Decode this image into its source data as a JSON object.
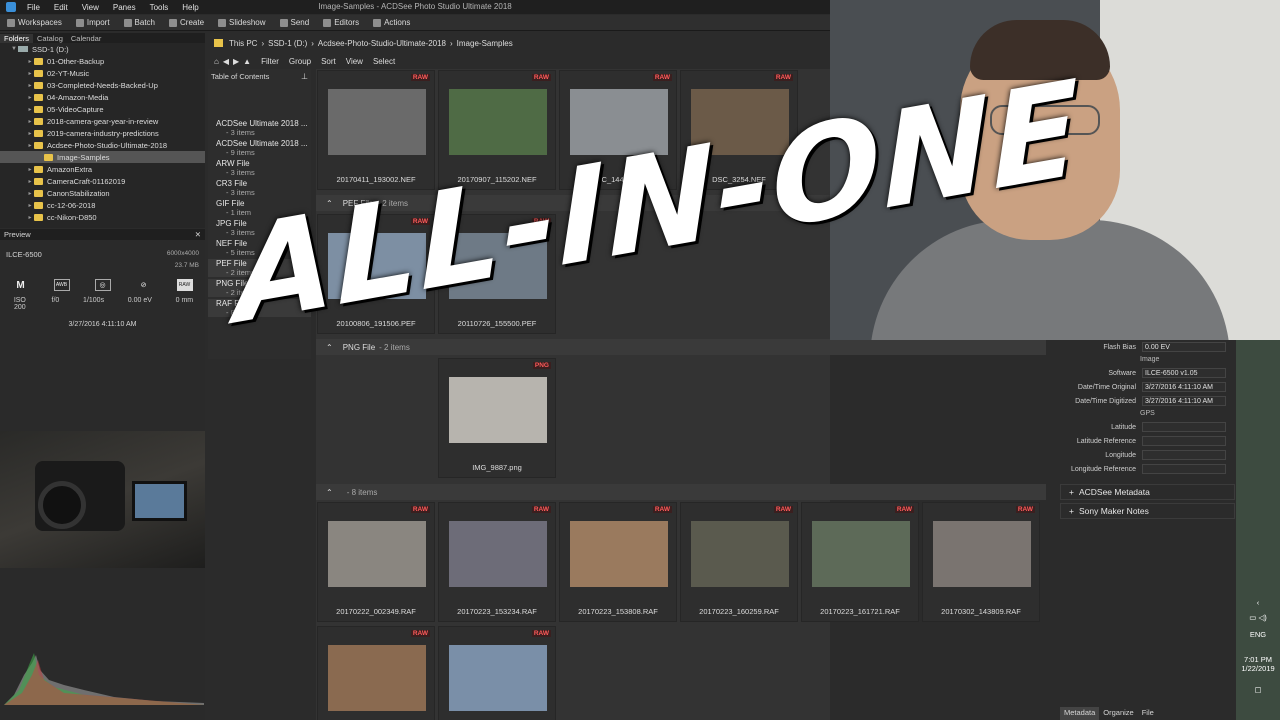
{
  "window": {
    "title": "Image-Samples - ACDSee Photo Studio Ultimate 2018"
  },
  "menu": [
    "File",
    "Edit",
    "View",
    "Panes",
    "Tools",
    "Help"
  ],
  "toolbar": [
    "Workspaces",
    "Import",
    "Batch",
    "Create",
    "Slideshow",
    "Send",
    "Editors",
    "Actions"
  ],
  "folders": {
    "tabs": [
      "Folders",
      "Catalog",
      "Calendar"
    ],
    "drive": "SSD-1 (D:)",
    "items": [
      {
        "label": "01-Other-Backup",
        "selected": false,
        "indent": 1
      },
      {
        "label": "02-YT-Music",
        "selected": false,
        "indent": 1
      },
      {
        "label": "03-Completed-Needs-Backed-Up",
        "selected": false,
        "indent": 1
      },
      {
        "label": "04-Amazon-Media",
        "selected": false,
        "indent": 1
      },
      {
        "label": "05-VideoCapture",
        "selected": false,
        "indent": 1
      },
      {
        "label": "2018-camera-gear-year-in-review",
        "selected": false,
        "indent": 1
      },
      {
        "label": "2019-camera-industry-predictions",
        "selected": false,
        "indent": 1
      },
      {
        "label": "Acdsee-Photo-Studio-Ultimate-2018",
        "selected": false,
        "indent": 1
      },
      {
        "label": "Image-Samples",
        "selected": true,
        "indent": 2
      },
      {
        "label": "AmazonExtra",
        "selected": false,
        "indent": 1
      },
      {
        "label": "CameraCraft-01162019",
        "selected": false,
        "indent": 1
      },
      {
        "label": "CanonStabilization",
        "selected": false,
        "indent": 1
      },
      {
        "label": "cc-12-06-2018",
        "selected": false,
        "indent": 1
      },
      {
        "label": "cc-Nikon-D850",
        "selected": false,
        "indent": 1
      }
    ]
  },
  "preview": {
    "title": "Preview",
    "camera": "ILCE-6500",
    "dimensions": "6000x4000",
    "filesize": "23.7 MB",
    "icons": [
      "M",
      "AWB",
      "metering",
      "flash-off",
      "RAW"
    ],
    "values": [
      "ISO 200",
      "f/0",
      "1/100s",
      "0.00 eV",
      "0 mm"
    ],
    "datetime": "3/27/2016 4:11:10 AM"
  },
  "path": {
    "segments": [
      "This PC",
      "SSD-1 (D:)",
      "Acdsee-Photo-Studio-Ultimate-2018",
      "Image-Samples"
    ]
  },
  "filterbar": [
    "Filter",
    "Group",
    "Sort",
    "View",
    "Select"
  ],
  "toc": {
    "title": "Table of Contents",
    "items": [
      {
        "name": "ACDSee Ultimate 2018 ...",
        "count": "- 3 items"
      },
      {
        "name": "ACDSee Ultimate 2018 ...",
        "count": "- 9 items"
      },
      {
        "name": "ARW File",
        "count": "- 3 items"
      },
      {
        "name": "CR3 File",
        "count": "- 3 items"
      },
      {
        "name": "GIF File",
        "count": "- 1 item"
      },
      {
        "name": "JPG File",
        "count": "- 3 items"
      },
      {
        "name": "NEF File",
        "count": "- 5 items"
      },
      {
        "name": "PEF File",
        "count": "- 2 items"
      },
      {
        "name": "PNG File",
        "count": "- 2 items"
      },
      {
        "name": "RAF File",
        "count": "- 8 items"
      }
    ]
  },
  "groups": [
    {
      "label": "PEF File",
      "count": "- 2 items"
    },
    {
      "label": "PNG File",
      "count": "- 2 items"
    },
    {
      "label": "",
      "count": "- 8 items"
    }
  ],
  "thumbs_row1": [
    {
      "name": "20170411_193002.NEF",
      "badge": "RAW",
      "color": "#6a6a6a"
    },
    {
      "name": "20170907_115202.NEF",
      "badge": "RAW",
      "color": "#4f6b45"
    },
    {
      "name": "DSC_1441.NEF",
      "badge": "RAW",
      "color": "#8a8e92"
    },
    {
      "name": "DSC_3254.NEF",
      "badge": "RAW",
      "color": "#6b5a48"
    }
  ],
  "thumbs_pef": [
    {
      "name": "20100806_191506.PEF",
      "badge": "RAW",
      "color": "#7d8fa3"
    },
    {
      "name": "20110726_155500.PEF",
      "badge": "RAW",
      "color": "#6e7a86"
    }
  ],
  "thumbs_png": [
    {
      "name": "IMG_9887.png",
      "badge": "PNG",
      "color": "#b7b4ae"
    }
  ],
  "thumbs_raf": [
    {
      "name": "20170222_002349.RAF",
      "badge": "RAW",
      "color": "#8a8680"
    },
    {
      "name": "20170223_153234.RAF",
      "badge": "RAW",
      "color": "#6d6c78"
    },
    {
      "name": "20170223_153808.RAF",
      "badge": "RAW",
      "color": "#9a7a5e"
    },
    {
      "name": "20170223_160259.RAF",
      "badge": "RAW",
      "color": "#5a5a4e"
    },
    {
      "name": "20170223_161721.RAF",
      "badge": "RAW",
      "color": "#5d6a58"
    },
    {
      "name": "20170302_143809.RAF",
      "badge": "RAW",
      "color": "#7a7470"
    }
  ],
  "thumbs_raf2": [
    {
      "badge": "RAW",
      "color": "#8a6a50"
    },
    {
      "badge": "RAW",
      "color": "#7a8fa8"
    }
  ],
  "metadata": {
    "rows1": [
      {
        "label": "Flash Bias",
        "value": "0.00 EV"
      }
    ],
    "section_image": "Image",
    "rows2": [
      {
        "label": "Software",
        "value": "ILCE-6500 v1.05"
      },
      {
        "label": "Date/Time Original",
        "value": "3/27/2016 4:11:10 AM"
      },
      {
        "label": "Date/Time Digitized",
        "value": "3/27/2016 4:11:10 AM"
      }
    ],
    "section_gps": "GPS",
    "rows3": [
      {
        "label": "Latitude",
        "value": ""
      },
      {
        "label": "Latitude Reference",
        "value": ""
      },
      {
        "label": "Longitude",
        "value": ""
      },
      {
        "label": "Longitude Reference",
        "value": ""
      }
    ],
    "sections": [
      "ACDSee Metadata",
      "Sony Maker Notes"
    ],
    "tabs": [
      "Metadata",
      "Organize",
      "File"
    ]
  },
  "taskbar": {
    "lang": "ENG",
    "time": "7:01 PM",
    "date": "1/22/2019"
  },
  "overlay": "ALL-IN-ONE"
}
